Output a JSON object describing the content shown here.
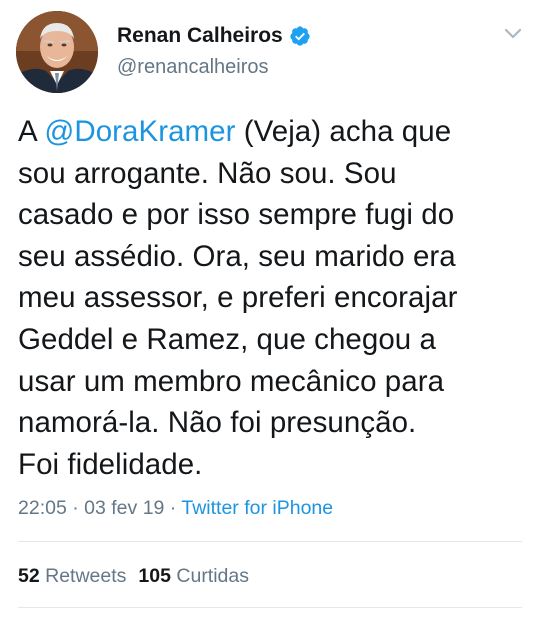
{
  "author": {
    "name": "Renan Calheiros",
    "handle": "@renancalheiros",
    "verified": true,
    "avatar_icon": "profile-photo"
  },
  "tweet": {
    "lines": [
      {
        "pre": "A ",
        "mention": "@DoraKramer",
        "post": " (Veja) acha que"
      },
      {
        "text": "sou arrogante. Não sou. Sou"
      },
      {
        "text": "casado e por isso sempre fugi do"
      },
      {
        "text": "seu assédio. Ora, seu marido era"
      },
      {
        "text": "meu assessor, e preferi encorajar"
      },
      {
        "text": "Geddel e Ramez, que chegou a"
      },
      {
        "text": "usar um membro mecânico para"
      },
      {
        "text": "namorá-la. Não foi presunção."
      },
      {
        "text": "Foi fidelidade."
      }
    ]
  },
  "meta": {
    "time": "22:05",
    "separator": " · ",
    "date": "03 fev 19",
    "source": "Twitter for iPhone"
  },
  "stats": {
    "retweets_count": "52",
    "retweets_label": "Retweets",
    "likes_count": "105",
    "likes_label": "Curtidas"
  },
  "colors": {
    "text": "#14171a",
    "secondary": "#657786",
    "link": "#1b95e0",
    "verified": "#1da1f2",
    "divider": "#e1e8ed"
  },
  "icons": {
    "verified": "verified-badge-icon",
    "menu": "chevron-down-icon"
  }
}
